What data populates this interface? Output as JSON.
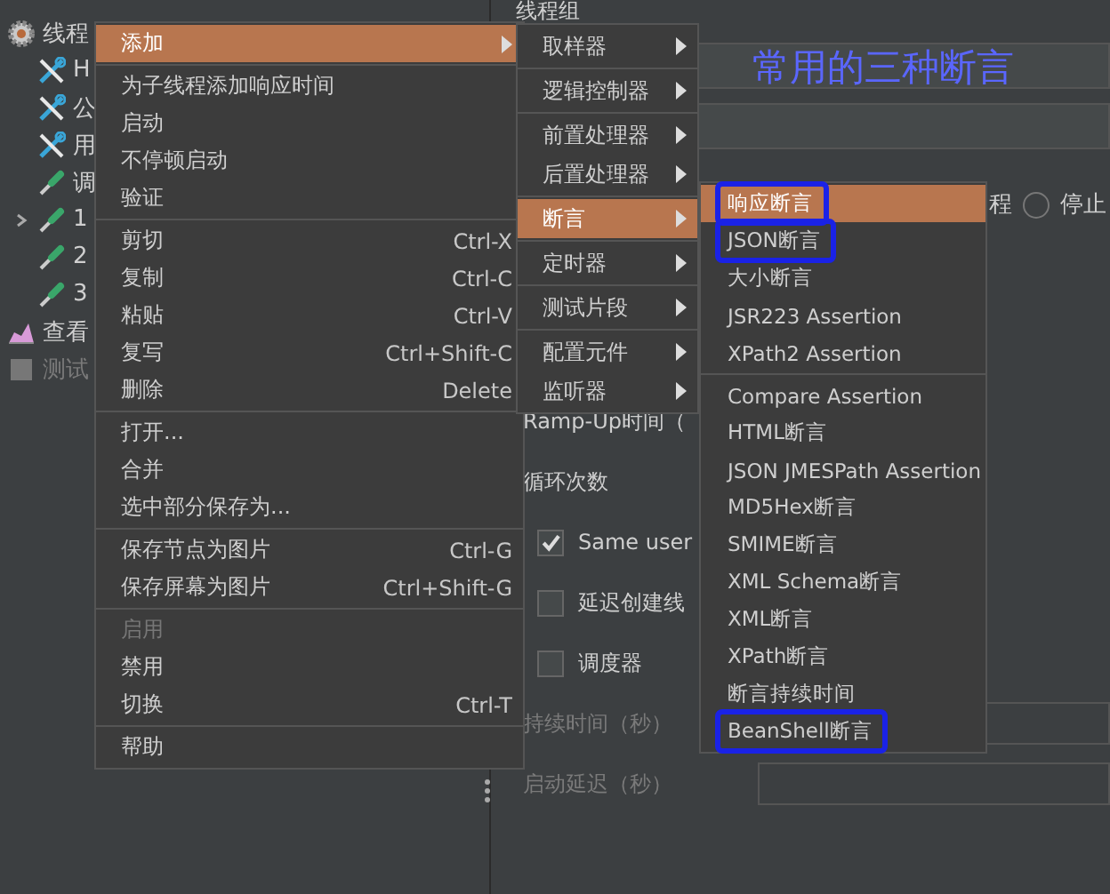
{
  "tree": [
    {
      "label": "线程",
      "kind": "gear",
      "children": [
        {
          "label": "H",
          "kind": "wrench"
        },
        {
          "label": "公",
          "kind": "wrench"
        },
        {
          "label": "用",
          "kind": "wrench"
        },
        {
          "label": "调",
          "kind": "dropper"
        },
        {
          "label": "1",
          "kind": "dropper",
          "expanded": false
        },
        {
          "label": "2",
          "kind": "dropper"
        },
        {
          "label": "3",
          "kind": "dropper"
        }
      ]
    },
    {
      "label": "查看",
      "kind": "chart"
    },
    {
      "label": "测试",
      "kind": "doc",
      "disabled": true
    }
  ],
  "panel": {
    "title": "线程组",
    "action_fragment": "程",
    "radio": {
      "label": "停止",
      "selected": false
    },
    "ramp_up_label": "Ramp-Up时间（",
    "loop_label": "循环次数",
    "checkboxes": [
      {
        "label": "Same user",
        "checked": true
      },
      {
        "label": "延迟创建线",
        "checked": false
      },
      {
        "label": "调度器",
        "checked": false
      }
    ],
    "disabled_fields": [
      {
        "label": "持续时间（秒）"
      },
      {
        "label": "启动延迟（秒）"
      }
    ]
  },
  "context_menu": {
    "groups": [
      [
        {
          "label": "添加",
          "submenu": true,
          "selected": true,
          "disabled": false
        }
      ],
      [
        {
          "label": "为子线程添加响应时间",
          "selected": false,
          "disabled": false
        },
        {
          "label": "启动",
          "selected": false,
          "disabled": false
        },
        {
          "label": "不停顿启动",
          "selected": false,
          "disabled": false
        },
        {
          "label": "验证",
          "selected": false,
          "disabled": false
        }
      ],
      [
        {
          "label": "剪切",
          "shortcut": "Ctrl-X",
          "selected": false,
          "disabled": false
        },
        {
          "label": "复制",
          "shortcut": "Ctrl-C",
          "selected": false,
          "disabled": false
        },
        {
          "label": "粘贴",
          "shortcut": "Ctrl-V",
          "selected": false,
          "disabled": false
        },
        {
          "label": "复写",
          "shortcut": "Ctrl+Shift-C",
          "selected": false,
          "disabled": false
        },
        {
          "label": "删除",
          "shortcut": "Delete",
          "selected": false,
          "disabled": false
        }
      ],
      [
        {
          "label": "打开...",
          "selected": false,
          "disabled": false
        },
        {
          "label": "合并",
          "selected": false,
          "disabled": false
        },
        {
          "label": "选中部分保存为...",
          "selected": false,
          "disabled": false
        }
      ],
      [
        {
          "label": "保存节点为图片",
          "shortcut": "Ctrl-G",
          "selected": false,
          "disabled": false
        },
        {
          "label": "保存屏幕为图片",
          "shortcut": "Ctrl+Shift-G",
          "selected": false,
          "disabled": false
        }
      ],
      [
        {
          "label": "启用",
          "selected": false,
          "disabled": true
        },
        {
          "label": "禁用",
          "selected": false,
          "disabled": false
        },
        {
          "label": "切换",
          "shortcut": "Ctrl-T",
          "selected": false,
          "disabled": false
        }
      ],
      [
        {
          "label": "帮助",
          "selected": false,
          "disabled": false
        }
      ]
    ]
  },
  "add_submenu": {
    "groups": [
      [
        {
          "label": "取样器",
          "selected": false
        }
      ],
      [
        {
          "label": "逻辑控制器",
          "selected": false
        }
      ],
      [
        {
          "label": "前置处理器",
          "selected": false
        },
        {
          "label": "后置处理器",
          "selected": false
        }
      ],
      [
        {
          "label": "断言",
          "selected": true
        }
      ],
      [
        {
          "label": "定时器",
          "selected": false
        }
      ],
      [
        {
          "label": "测试片段",
          "selected": false
        }
      ],
      [
        {
          "label": "配置元件",
          "selected": false
        },
        {
          "label": "监听器",
          "selected": false
        }
      ]
    ]
  },
  "assertion_submenu": {
    "groups": [
      [
        {
          "label": "响应断言",
          "selected": true,
          "circled": true
        },
        {
          "label": "JSON断言",
          "selected": false,
          "circled": true
        },
        {
          "label": "大小断言",
          "selected": false,
          "circled": false
        },
        {
          "label": "JSR223 Assertion",
          "selected": false,
          "circled": false
        },
        {
          "label": "XPath2 Assertion",
          "selected": false,
          "circled": false
        }
      ],
      [
        {
          "label": "Compare Assertion",
          "selected": false,
          "circled": false
        },
        {
          "label": "HTML断言",
          "selected": false,
          "circled": false
        },
        {
          "label": "JSON JMESPath Assertion",
          "selected": false,
          "circled": false
        },
        {
          "label": "MD5Hex断言",
          "selected": false,
          "circled": false
        },
        {
          "label": "SMIME断言",
          "selected": false,
          "circled": false
        },
        {
          "label": "XML Schema断言",
          "selected": false,
          "circled": false
        },
        {
          "label": "XML断言",
          "selected": false,
          "circled": false
        },
        {
          "label": "XPath断言",
          "selected": false,
          "circled": false
        },
        {
          "label": "断言持续时间",
          "selected": false,
          "circled": false
        },
        {
          "label": "BeanShell断言",
          "selected": false,
          "circled": true
        }
      ]
    ]
  },
  "annotation": {
    "text": "常用的三种断言"
  }
}
